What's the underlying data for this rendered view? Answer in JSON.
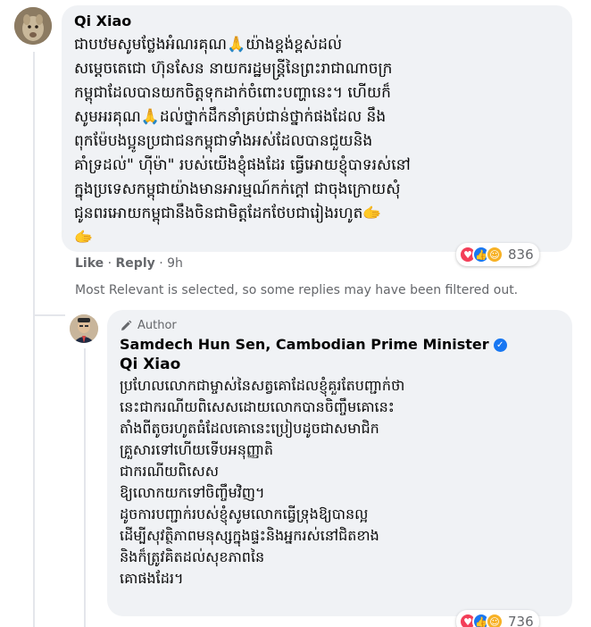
{
  "comment1": {
    "author": "Qi Xiao",
    "text": "ជាបឋមសូមថ្លែងអំណរគុណ🙏យ៉ាងខ្ពង់ខ្ពស់ដល់\nសម្តេចតេជោ ហ៊ុនសែន នាយករដ្ឋមន្ត្រីនៃព្រះរាជាណាចក្រ\nកម្ពុជាដែលបានយកចិត្តទុកដាក់ចំពោះបញ្ហានេះ។ ហើយក៏\nសូមអរគុណ🙏ដល់ថ្នាក់ដឹកនាំគ្រប់ជាន់ថ្នាក់ផងដែល នឹង\nពុកម៉ែបងប្អូនប្រជាជនកម្ពុជាទាំងអស់ដែលបានជួយនិង\nគាំទ្រដល់\" ហ៊ីម៉ា\" របស់យើងខ្ញុំផងដែរ ធ្វើអោយខ្ញុំបាទរស់នៅ\nក្នុងប្រទេសកម្ពុជាយ៉ាងមានអារម្មណ៍កក់ក្តៅ ជាចុងក្រោយសុំ\nជូនពរអោយកម្ពុជានឹងចិនជាមិត្តដែកថែបជារៀងរហូត🫱\n🫱",
    "reactions": {
      "count": "836"
    },
    "actions": {
      "like": "Like",
      "sep": "·",
      "reply": "Reply",
      "time": "9h"
    }
  },
  "filter_note": "Most Relevant is selected, so some replies may have been filtered out.",
  "reply1": {
    "badge": "Author",
    "author": "Samdech Hun Sen, Cambodian Prime Minister",
    "mention": "Qi Xiao",
    "text": "ប្រហែលលោកជាម្ចាស់នៃសត្វគោដែលខ្ញុំគួរតែបញ្ជាក់ថា\nនេះជាករណីយពិសេសដោយលោកបានចិញ្ចឹមគោនេះ\nតាំងពីតូចរហូតធំដែលគោនេះប្រៀបដូចជាសមាជិក\nគ្រួសារទៅហើយទើបអនុញ្ញាតិ\nជាករណីយពិសេស\nឱ្យលោកយកទៅចិញ្ចឹមវិញ។\nដូចការបញ្ជាក់របស់ខ្ញុំសូមលោកធ្វើទ្រុងឱ្យបានល្អ\nដើម្បីសុវត្ថិភាពមនុស្សក្នុងផ្ទះនិងអ្នករស់នៅជិតខាង\nនិងក៏ត្រូវគិតដល់សុខភាពនៃ\nគោផងដែរ។",
    "reactions": {
      "count": "736"
    }
  }
}
